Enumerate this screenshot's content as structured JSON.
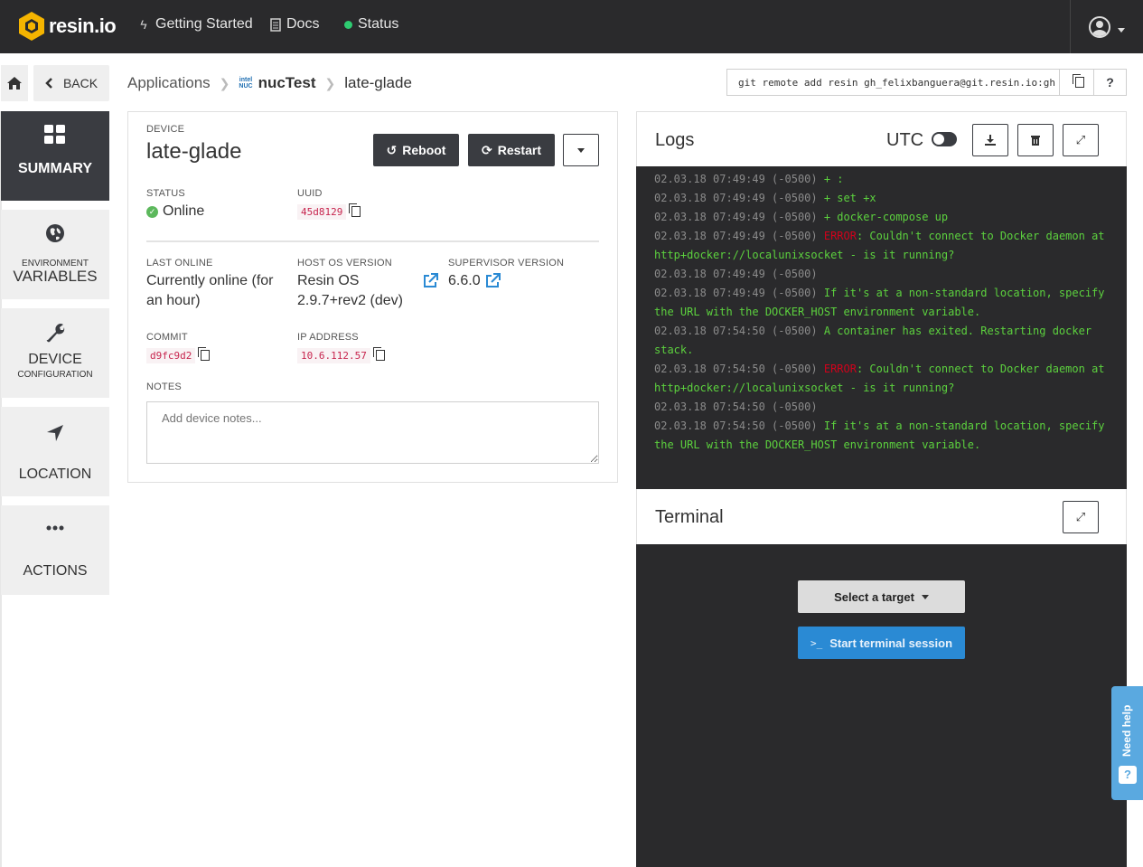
{
  "topbar": {
    "brand": "resin.io",
    "links": [
      {
        "label": "Getting Started",
        "icon": "bolt-icon"
      },
      {
        "label": "Docs",
        "icon": "document-icon"
      },
      {
        "label": "Status",
        "icon": "status-dot"
      }
    ],
    "status_color": "#2ecc71"
  },
  "sidebar": {
    "back_label": "BACK",
    "items": [
      {
        "small": "",
        "big": "SUMMARY",
        "icon": "grid-icon",
        "active": true
      },
      {
        "small": "ENVIRONMENT",
        "big": "VARIABLES",
        "icon": "globe-icon"
      },
      {
        "big": "DEVICE",
        "small": "CONFIGURATION",
        "icon": "wrench-icon"
      },
      {
        "big": "LOCATION",
        "icon": "location-arrow-icon"
      },
      {
        "big": "ACTIONS",
        "icon": "ellipsis-icon"
      }
    ]
  },
  "breadcrumb": {
    "root": "Applications",
    "app_badge_top": "intel",
    "app_badge_bottom": "NUC",
    "app": "nucTest",
    "device": "late-glade"
  },
  "git": {
    "command": "git remote add resin gh_felixbanguera@git.resin.io:gh",
    "help": "?"
  },
  "device": {
    "section_label": "DEVICE",
    "name": "late-glade",
    "reboot_label": "Reboot",
    "restart_label": "Restart",
    "status_label": "STATUS",
    "status_value": "Online",
    "uuid_label": "UUID",
    "uuid_value": "45d8129",
    "last_online_label": "LAST ONLINE",
    "last_online_value": "Currently online (for an hour)",
    "host_os_label": "HOST OS VERSION",
    "host_os_value_1": "Resin OS",
    "host_os_value_2": "2.9.7+rev2 (dev)",
    "supervisor_label": "SUPERVISOR VERSION",
    "supervisor_value": "6.6.0",
    "commit_label": "COMMIT",
    "commit_value": "d9fc9d2",
    "ip_label": "IP ADDRESS",
    "ip_value": "10.6.112.57",
    "notes_label": "NOTES",
    "notes_placeholder": "Add device notes..."
  },
  "logs": {
    "title": "Logs",
    "utc_label": "UTC",
    "lines": [
      {
        "ts": "02.03.18 07:49:49 (-0500)",
        "text": " + :"
      },
      {
        "ts": "02.03.18 07:49:49 (-0500)",
        "text": " + set +x"
      },
      {
        "ts": "02.03.18 07:49:49 (-0500)",
        "text": " + docker-compose up"
      },
      {
        "ts": "02.03.18 07:49:49 (-0500)",
        "err": "ERROR",
        "text": ": Couldn't connect to Docker daemon at http+docker://localunixsocket - is it running?"
      },
      {
        "ts": "02.03.18 07:49:49 (-0500)",
        "text": ""
      },
      {
        "ts": "02.03.18 07:49:49 (-0500)",
        "text": " If it's at a non-standard location, specify the URL with the DOCKER_HOST environment variable."
      },
      {
        "ts": "02.03.18 07:54:50 (-0500)",
        "text": " A container has exited. Restarting docker stack."
      },
      {
        "ts": "02.03.18 07:54:50 (-0500)",
        "err": "ERROR",
        "text": ": Couldn't connect to Docker daemon at http+docker://localunixsocket - is it running?"
      },
      {
        "ts": "02.03.18 07:54:50 (-0500)",
        "text": ""
      },
      {
        "ts": "02.03.18 07:54:50 (-0500)",
        "text": " If it's at a non-standard location, specify the URL with the DOCKER_HOST environment variable."
      }
    ]
  },
  "terminal": {
    "title": "Terminal",
    "select_label": "Select a target",
    "start_label": "Start terminal session",
    "start_prompt": ">_"
  },
  "help_widget": {
    "label": "Need help",
    "icon": "?"
  }
}
